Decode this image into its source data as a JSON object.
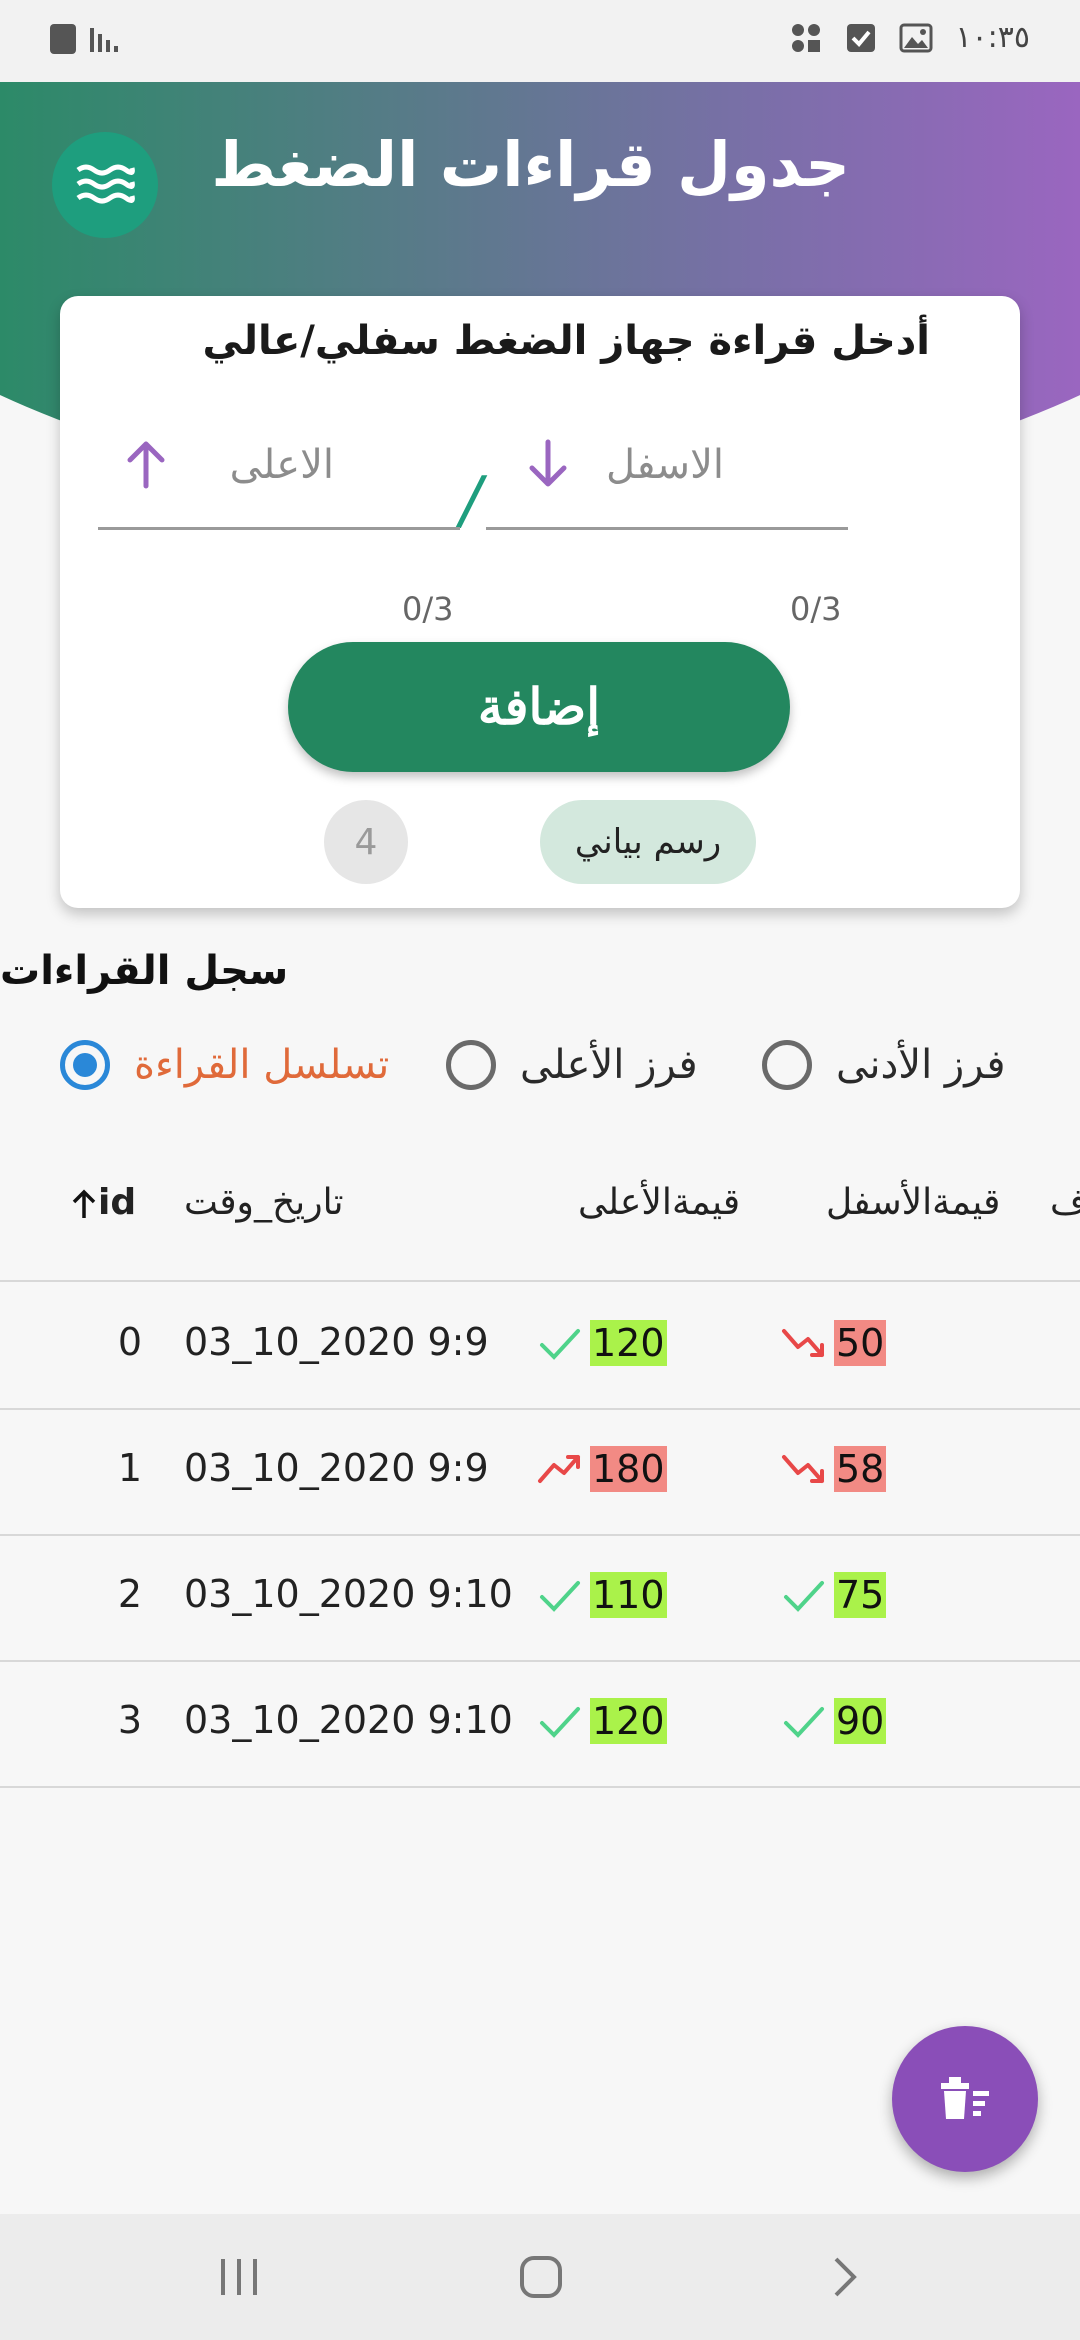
{
  "status_bar": {
    "time": "١٠:٣٥"
  },
  "header": {
    "title": "جدول قراءات الضغط",
    "logo_icon": "waves-icon"
  },
  "entry_card": {
    "title": "أدخل قراءة جهاز الضغط سفلي/عالي",
    "low_field": {
      "label": "الاسفل",
      "counter": "0/3",
      "icon": "arrow-down-icon"
    },
    "high_field": {
      "label": "الاعلى",
      "counter": "0/3",
      "icon": "arrow-up-icon"
    },
    "separator": "/",
    "add_button": "إضافة",
    "count_badge": "4",
    "chart_button": "رسم بياني"
  },
  "log": {
    "title": "سجل القراءات",
    "sort_options": [
      {
        "label": "تسلسل القراءة",
        "selected": true
      },
      {
        "label": "فرز الأعلى",
        "selected": false
      },
      {
        "label": "فرز الأدنى",
        "selected": false
      }
    ],
    "columns": {
      "id": "id",
      "date": "تاريخ_وقت",
      "high": "قيمةالأعلى",
      "low": "قيمةالأسفل",
      "cut": "ف"
    },
    "rows": [
      {
        "id": "0",
        "date": "03_10_2020 9:9",
        "high": "120",
        "high_status": "ok",
        "low": "50",
        "low_status": "down"
      },
      {
        "id": "1",
        "date": "03_10_2020 9:9",
        "high": "180",
        "high_status": "up",
        "low": "58",
        "low_status": "down"
      },
      {
        "id": "2",
        "date": "03_10_2020 9:10",
        "high": "110",
        "high_status": "ok",
        "low": "75",
        "low_status": "ok"
      },
      {
        "id": "3",
        "date": "03_10_2020 9:10",
        "high": "120",
        "high_status": "ok",
        "low": "90",
        "low_status": "ok"
      }
    ]
  },
  "fab_icon": "delete-sweep-icon",
  "colors": {
    "primary_green": "#23875f",
    "accent_purple": "#8a4eb8",
    "ok_bg": "#aaf24a",
    "bad_bg": "#f28a84",
    "sort_active": "#e06a3a"
  }
}
